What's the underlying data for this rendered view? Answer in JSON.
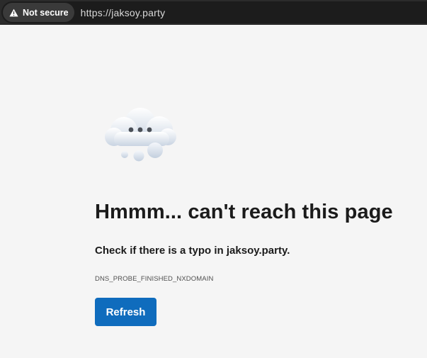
{
  "browser": {
    "security_label": "Not secure",
    "security_icon": "warning-triangle-icon",
    "url": "https://jaksoy.party"
  },
  "error_page": {
    "illustration": "cloud-thinking-icon",
    "headline": "Hmmm... can't reach this page",
    "hint": "Check if there is a typo in jaksoy.party.",
    "error_code": "DNS_PROBE_FINISHED_NXDOMAIN",
    "refresh_label": "Refresh"
  },
  "colors": {
    "page_background": "#f5f5f5",
    "toolbar_background": "#2b2b2b",
    "button_blue": "#0f6cbd",
    "text_primary": "#1b1b1b"
  }
}
